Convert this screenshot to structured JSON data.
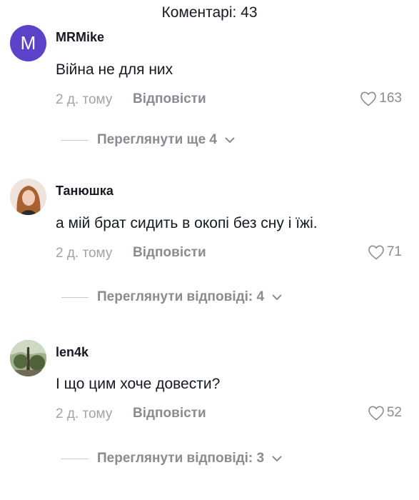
{
  "header": {
    "title": "Коментарі: 43"
  },
  "colors": {
    "avatar_m": "#5a43c8",
    "muted": "#8a8b91"
  },
  "comments": [
    {
      "username": "MRMike",
      "avatar_letter": "M",
      "text": "Війна не для них",
      "time": "2 д. тому",
      "reply_label": "Відповісти",
      "likes": "163",
      "view_more": "Переглянути ще 4"
    },
    {
      "username": "Танюшка",
      "text": "а мій брат сидить в окопі без сну і їжі.",
      "time": "2 д. тому",
      "reply_label": "Відповісти",
      "likes": "71",
      "view_more": "Переглянути відповіді: 4"
    },
    {
      "username": "len4k",
      "text": "І що цим хоче довести?",
      "time": "2 д. тому",
      "reply_label": "Відповісти",
      "likes": "52",
      "view_more": "Переглянути відповіді: 3"
    }
  ]
}
